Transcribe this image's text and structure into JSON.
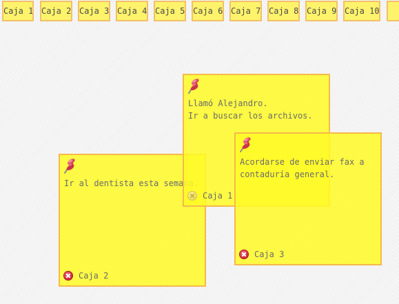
{
  "tabs": [
    {
      "label": "Caja 1"
    },
    {
      "label": "Caja 2"
    },
    {
      "label": "Caja 3"
    },
    {
      "label": "Caja 4"
    },
    {
      "label": "Caja 5"
    },
    {
      "label": "Caja 6"
    },
    {
      "label": "Caja 7"
    },
    {
      "label": "Caja 8"
    },
    {
      "label": "Caja 9"
    },
    {
      "label": "Caja 10"
    }
  ],
  "notes": {
    "note1": {
      "lines": [
        "Llamó Alejandro.",
        "Ir a buscar los archivos."
      ],
      "footer_label": "Caja 1",
      "pin_icon": "pushpin-icon",
      "close_icon": "close-icon"
    },
    "note2": {
      "lines": [
        "Ir al dentista esta semana."
      ],
      "footer_label": "Caja 2",
      "pin_icon": "pushpin-icon",
      "close_icon": "close-icon"
    },
    "note3": {
      "lines": [
        "Acordarse de enviar fax a",
        "contaduría general."
      ],
      "footer_label": "Caja 3",
      "pin_icon": "pushpin-icon",
      "close_icon": "close-icon"
    }
  },
  "colors": {
    "note_fill": "#fffa28",
    "note_border": "#f5b94a",
    "tab_fill": "#fff36b",
    "close_red": "#d3263a",
    "pin_red": "#e8556a"
  }
}
